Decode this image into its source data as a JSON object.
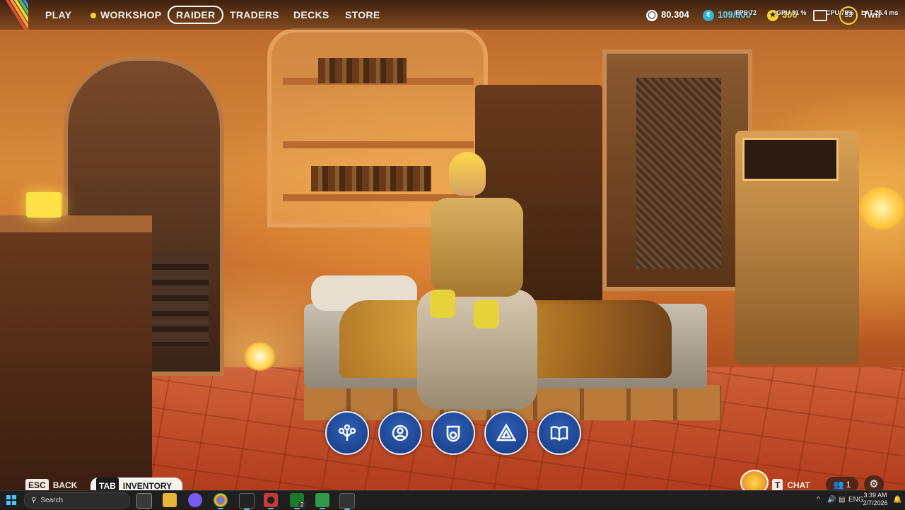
{
  "nav": {
    "play": "PLAY",
    "workshop": "WORKSHOP",
    "raider": "RAIDER",
    "traders": "TRADERS",
    "decks": "DECKS",
    "store": "STORE"
  },
  "currency": {
    "coins": "80.304",
    "seeds": "109/800",
    "tokens": "300"
  },
  "perf_overlay": {
    "fps": "FPS 72",
    "gpu": "GPU 91 %",
    "cpu": "CPU 79%",
    "latency": "LAT 25.4 ms"
  },
  "profile": {
    "level": "53",
    "name": "Twil"
  },
  "actions": [
    {
      "icon": "skill-tree-icon"
    },
    {
      "icon": "loadout-gear-icon"
    },
    {
      "icon": "stats-badge-icon"
    },
    {
      "icon": "triangle-rank-icon"
    },
    {
      "icon": "codex-book-icon"
    }
  ],
  "hints": {
    "back_key": "ESC",
    "back_label": "BACK",
    "inventory_key": "TAB",
    "inventory_label": "INVENTORY",
    "chat_key": "T",
    "chat_label": "CHAT",
    "friends_count": "1"
  },
  "taskbar": {
    "search_placeholder": "Search",
    "language": "ENG",
    "time": "3:39 AM",
    "date": "2/7/2026",
    "xbox_badge": "2"
  },
  "colors": {
    "accent_blue": "#1f4fa6",
    "seed_teal": "#29b6d8",
    "gold": "#f5d33a",
    "taskbar": "#1f1f1f"
  }
}
